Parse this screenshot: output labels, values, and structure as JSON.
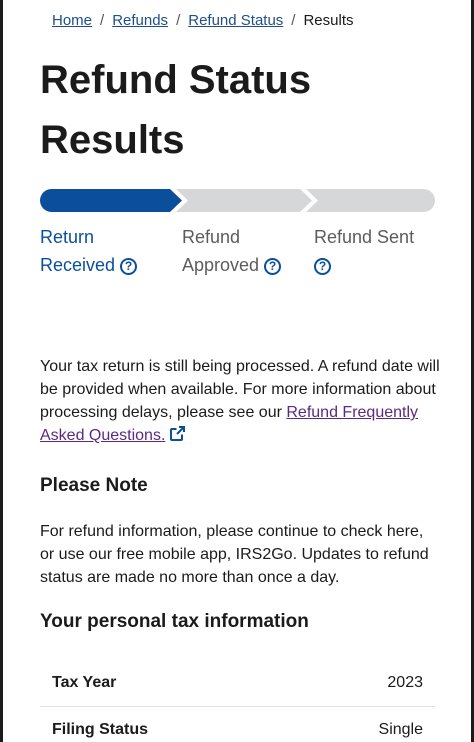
{
  "breadcrumb": {
    "items": [
      "Home",
      "Refunds",
      "Refund Status"
    ],
    "current": "Results"
  },
  "page_title": "Refund Status Results",
  "tracker": {
    "steps": [
      {
        "line1": "Return",
        "line2": "Received",
        "state": "complete"
      },
      {
        "line1": "Refund",
        "line2": "Approved",
        "state": "pending"
      },
      {
        "line1": "Refund Sent",
        "line2": "",
        "state": "pending"
      }
    ],
    "help_glyph": "?",
    "active_color": "#0b4f9c",
    "inactive_color": "#d6d7d9"
  },
  "status_message": {
    "text": "Your tax return is still being processed. A refund date will be provided when available. For more information about processing delays, please see our ",
    "link_text": "Refund Frequently Asked Questions.",
    "link_icon": "external-link-icon"
  },
  "note": {
    "heading": "Please Note",
    "text": "For refund information, please continue to check here, or use our free mobile app, IRS2Go. Updates to refund status are made no more than once a day."
  },
  "personal_info": {
    "heading": "Your personal tax information",
    "rows": [
      {
        "label": "Tax Year",
        "value": "2023"
      },
      {
        "label": "Filing Status",
        "value": "Single"
      }
    ]
  }
}
